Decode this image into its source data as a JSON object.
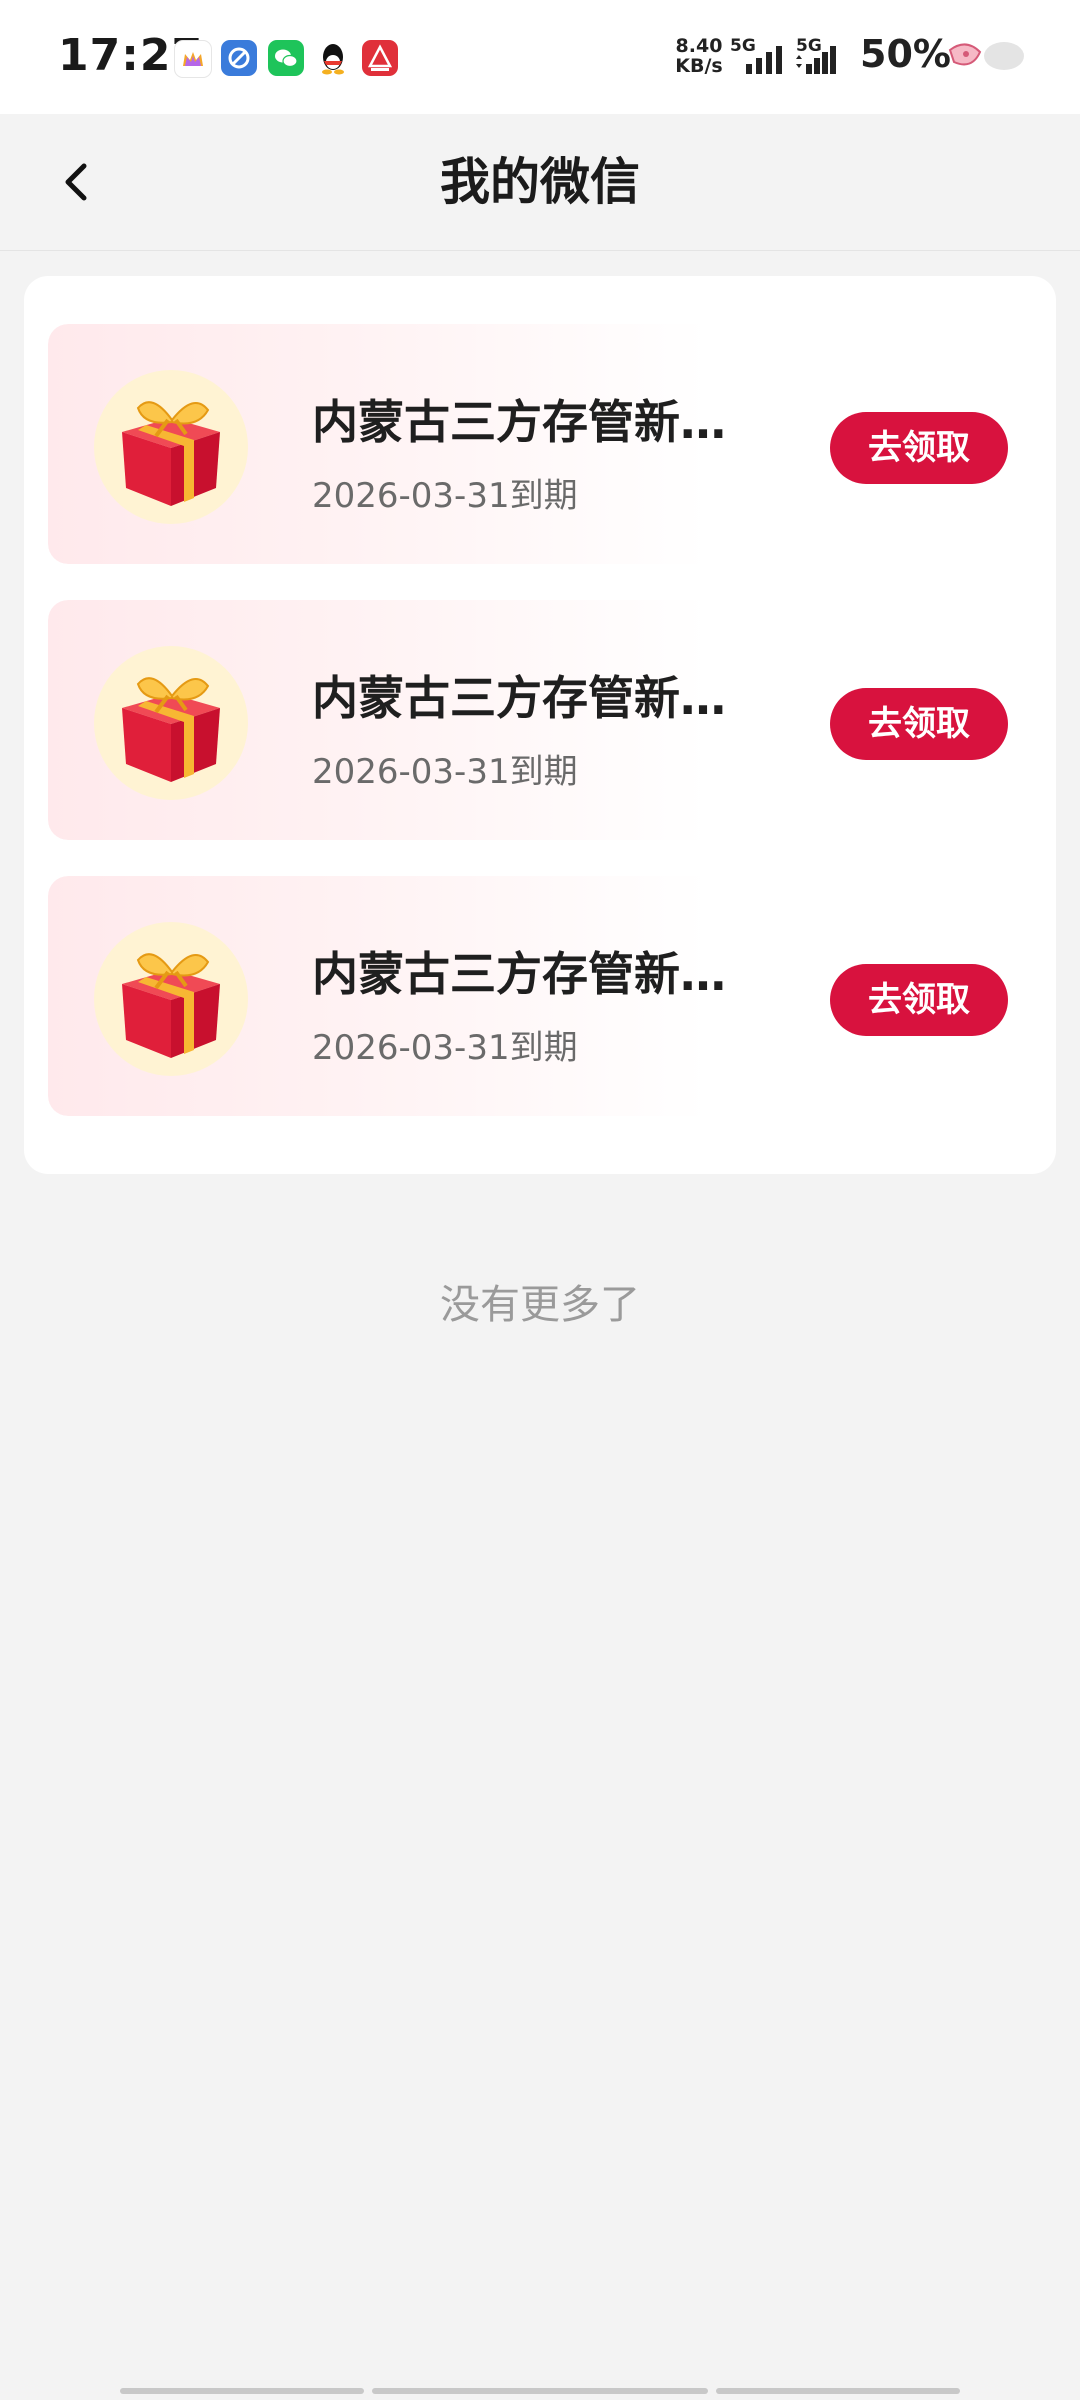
{
  "status_bar": {
    "time": "17:27",
    "net_speed_value": "8.40",
    "net_speed_unit": "KB/s",
    "network_1": "5G",
    "network_2": "5G",
    "battery": "50%",
    "app_icons": [
      "crown-app-icon",
      "browser-app-icon",
      "wechat-icon",
      "qq-icon",
      "red-app-icon"
    ]
  },
  "header": {
    "title": "我的微信",
    "back_icon": "chevron-left-icon"
  },
  "coupons": [
    {
      "title": "内蒙古三方存管新…",
      "expiry": "2026-03-31到期",
      "button": "去领取",
      "icon": "gift-box-icon"
    },
    {
      "title": "内蒙古三方存管新…",
      "expiry": "2026-03-31到期",
      "button": "去领取",
      "icon": "gift-box-icon"
    },
    {
      "title": "内蒙古三方存管新…",
      "expiry": "2026-03-31到期",
      "button": "去领取",
      "icon": "gift-box-icon"
    }
  ],
  "footer_text": "没有更多了",
  "colors": {
    "accent": "#d8123e",
    "page_bg": "#f3f3f3",
    "card_bg": "#ffffff"
  }
}
